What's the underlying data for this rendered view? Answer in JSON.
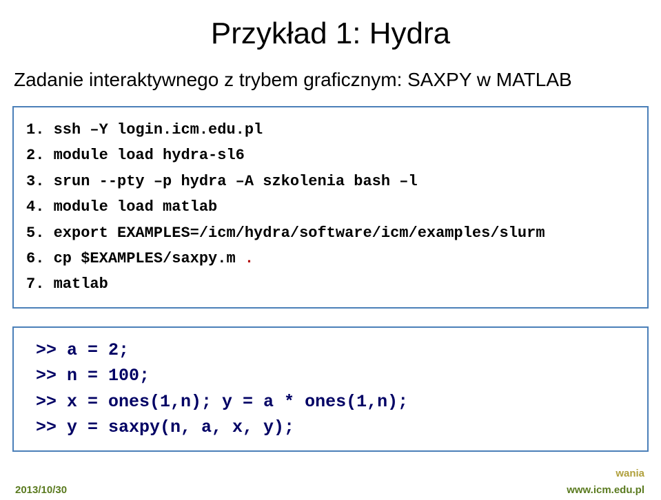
{
  "title": "Przykład 1: Hydra",
  "subtitle": "Zadanie interaktywnego z trybem graficznym: SAXPY w MATLAB",
  "commands": {
    "l1": {
      "num": "1. ",
      "text": "ssh –Y login.icm.edu.pl"
    },
    "l2": {
      "num": "2. ",
      "text": "module load hydra-sl6"
    },
    "l3": {
      "num": "3. ",
      "text": "srun --pty –p hydra –A szkolenia bash –l"
    },
    "l4": {
      "num": "4. ",
      "text": "module load matlab"
    },
    "l5": {
      "num": "5. ",
      "text": "export EXAMPLES=/icm/hydra/software/icm/examples/slurm"
    },
    "l6": {
      "num": "6. ",
      "pre": "cp $EXAMPLES/saxpy.m ",
      "red": "."
    },
    "l7": {
      "num": "7. ",
      "text": "matlab"
    }
  },
  "output": {
    "o1": ">> a = 2;",
    "o2": ">> n = 100;",
    "o3": ">> x = ones(1,n); y = a * ones(1,n);",
    "o4": ">> y = saxpy(n, a, x, y);"
  },
  "footer": {
    "date": "2013/10/30",
    "url": "www.icm.edu.pl",
    "fragment": "wania"
  }
}
